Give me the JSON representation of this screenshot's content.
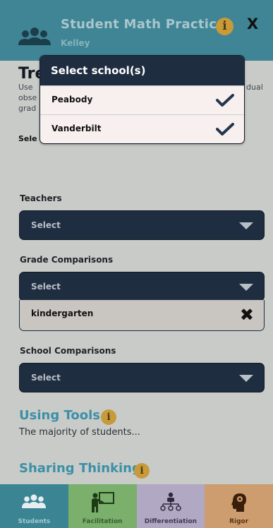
{
  "header": {
    "title": "Student Math Practices",
    "subtitle": "Kelley",
    "info_glyph": "i",
    "close_glyph": "X",
    "icons": [
      "users-icon",
      "info-icon",
      "close-icon"
    ]
  },
  "main": {
    "heading_partial": "Tre",
    "desc_left": [
      "Use",
      "obse",
      "grad"
    ],
    "desc_right": "dual",
    "select_label_partial": "Sele"
  },
  "teachers": {
    "label": "Teachers",
    "placeholder": "Select"
  },
  "grade": {
    "label": "Grade Comparisons",
    "placeholder": "Select",
    "selected": "kindergarten",
    "remove_glyph": "✖"
  },
  "school": {
    "label": "School Comparisons",
    "placeholder": "Select"
  },
  "tools": [
    {
      "title": "Using Tools",
      "text": "The majority of students..."
    },
    {
      "title": "Sharing Thinking",
      "text": ""
    }
  ],
  "popup": {
    "title": "Select school(s)",
    "options": [
      {
        "label": "Peabody",
        "checked": true
      },
      {
        "label": "Vanderbilt",
        "checked": true
      }
    ]
  },
  "tabs": [
    {
      "label": "Students",
      "icon": "students-icon",
      "color": "#3a8494"
    },
    {
      "label": "Facilitation",
      "icon": "teacher-board-icon",
      "color": "#7aaf6c"
    },
    {
      "label": "Differentiation",
      "icon": "hierarchy-icon",
      "color": "#b1a8c3"
    },
    {
      "label": "Rigor",
      "icon": "brain-head-icon",
      "color": "#cd9d6f"
    }
  ],
  "colors": {
    "header": "#3f8595",
    "dropdown": "#1f2d40",
    "accent_blue": "#3c90a6",
    "info_gold": "#c99a37",
    "check": "#23364e"
  }
}
